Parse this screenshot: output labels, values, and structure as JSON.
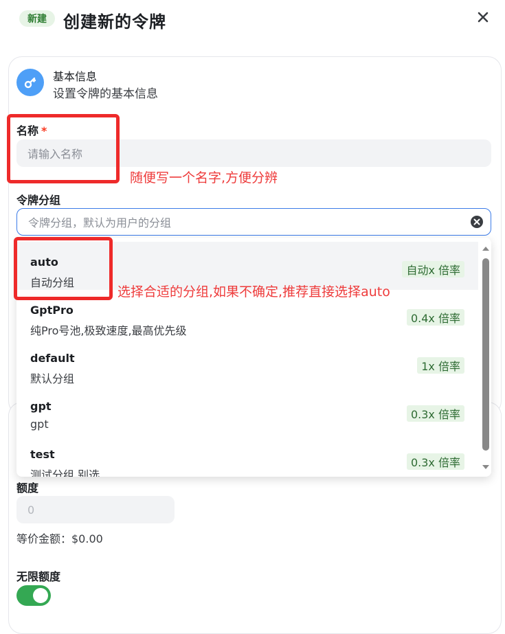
{
  "header": {
    "badge": "新建",
    "title": "创建新的令牌"
  },
  "section": {
    "title": "基本信息",
    "subtitle": "设置令牌的基本信息",
    "icon": "key-icon"
  },
  "name_field": {
    "label": "名称",
    "required_mark": "*",
    "placeholder": "请输入名称"
  },
  "group_field": {
    "label": "令牌分组",
    "placeholder": "令牌分组，默认为用户的分组"
  },
  "group_options": [
    {
      "name": "auto",
      "desc": "自动分组",
      "rate": "自动x 倍率",
      "selected": true
    },
    {
      "name": "GptPro",
      "desc": "纯Pro号池,极致速度,最高优先级",
      "rate": "0.4x 倍率",
      "selected": false
    },
    {
      "name": "default",
      "desc": "默认分组",
      "rate": "1x 倍率",
      "selected": false
    },
    {
      "name": "gpt",
      "desc": "gpt",
      "rate": "0.3x 倍率",
      "selected": false
    },
    {
      "name": "test",
      "desc": "测试分组,别选",
      "rate": "0.3x 倍率",
      "selected": false
    }
  ],
  "quota_field": {
    "label": "额度",
    "placeholder": "0",
    "equivalent": "等价金额：$0.00"
  },
  "unlimited": {
    "label": "无限额度",
    "enabled": true
  },
  "annotations": {
    "name_note": "随便写一个名字,方便分辨",
    "group_note": "选择合适的分组,如果不确定,推荐直接选择auto"
  },
  "colors": {
    "accent": "#3b7be8",
    "badge_bg": "#e7f4e6",
    "annotation": "#ee2a2a",
    "toggle_on": "#34a853"
  }
}
